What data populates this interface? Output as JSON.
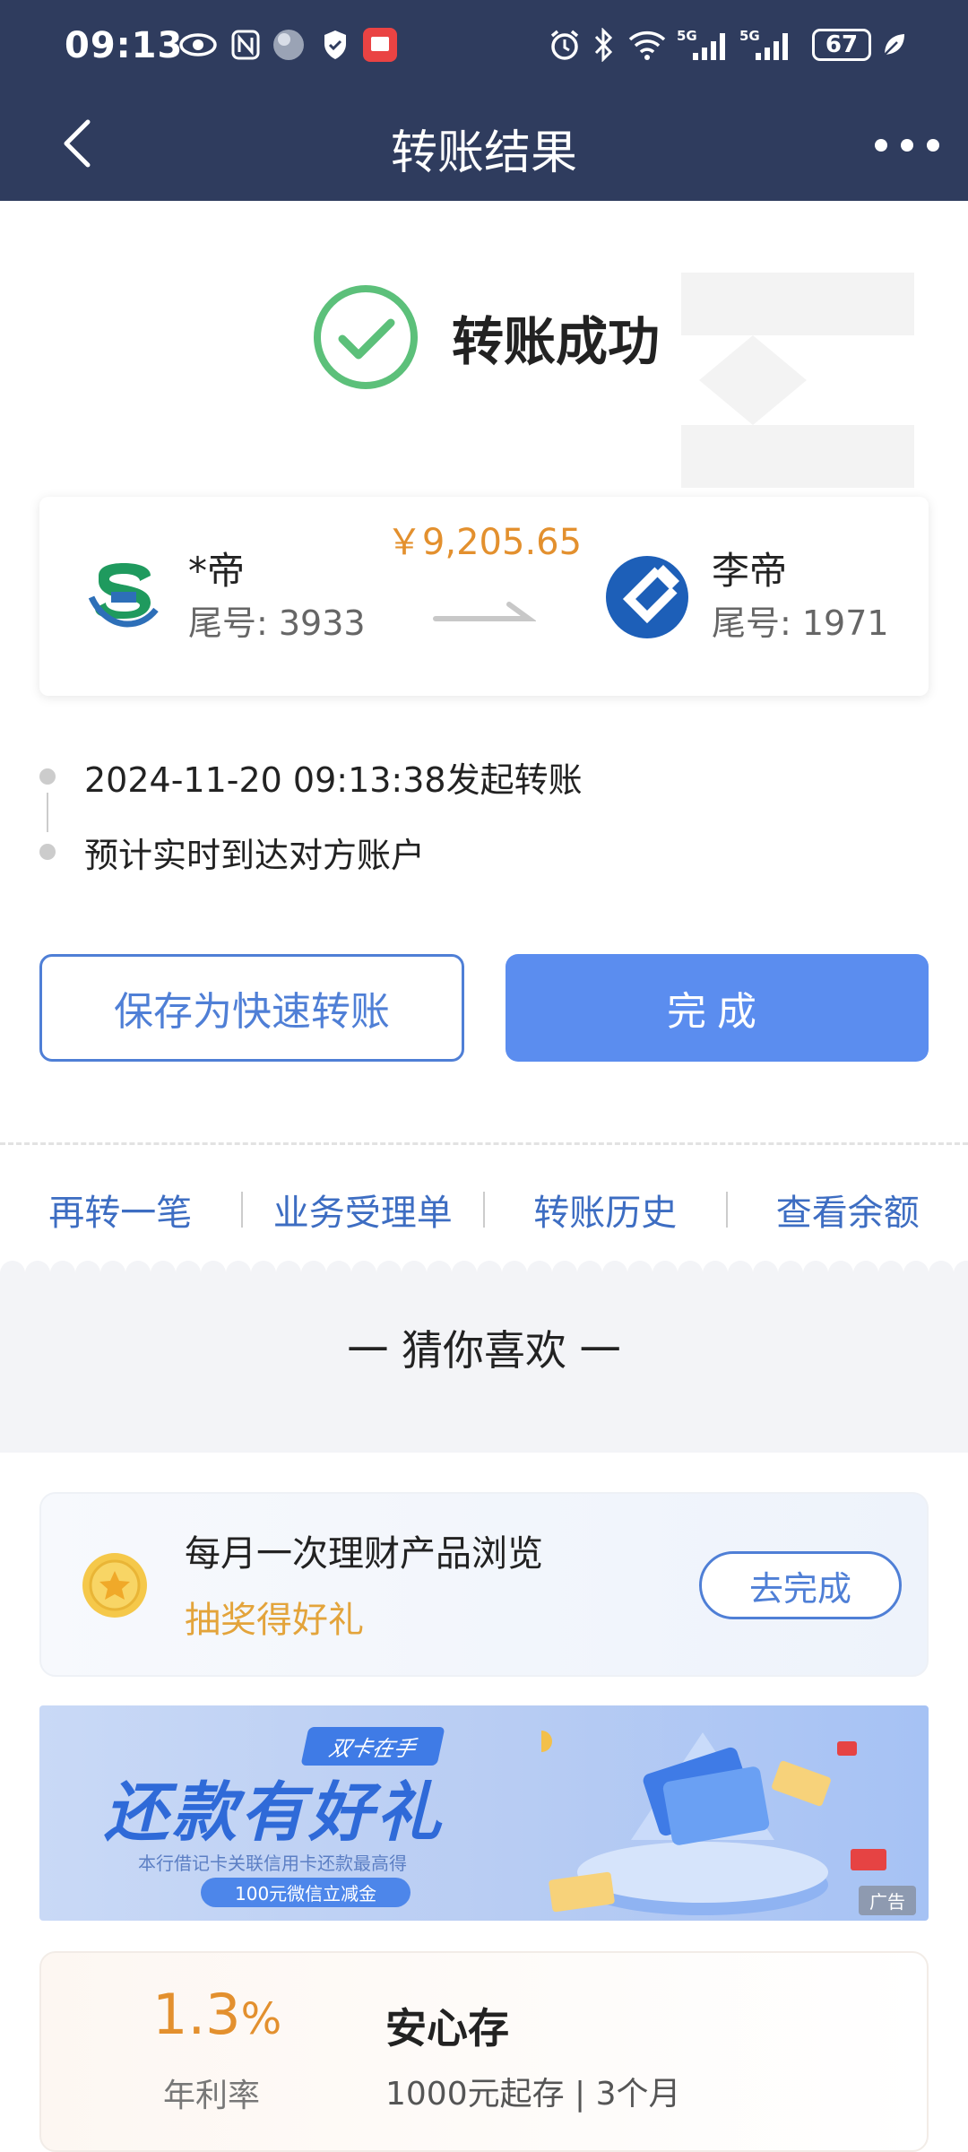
{
  "status_bar": {
    "time": "09:13",
    "battery": "67",
    "network_1": "5G",
    "network_2": "5G"
  },
  "header": {
    "title": "转账结果"
  },
  "result": {
    "status_text": "转账成功"
  },
  "transfer": {
    "amount": "￥9,205.65",
    "from": {
      "name": "*帝",
      "tail": "尾号: 3933"
    },
    "to": {
      "name": "李帝",
      "tail": "尾号: 1971"
    }
  },
  "timeline": [
    "2024-11-20 09:13:38发起转账",
    "预计实时到达对方账户"
  ],
  "buttons": {
    "save_quick": "保存为快速转账",
    "done": "完成"
  },
  "quick_links": [
    "再转一笔",
    "业务受理单",
    "转账历史",
    "查看余额"
  ],
  "recommend": {
    "heading": "一 猜你喜欢 一",
    "task": {
      "title": "每月一次理财产品浏览",
      "subtitle": "抽奖得好礼",
      "button": "去完成"
    },
    "banner": {
      "tag": "双卡在手",
      "title": "还款有好礼",
      "subtitle": "本行借记卡关联信用卡还款最高得",
      "pill": "100元微信立减金",
      "ad": "广告"
    },
    "deposit": {
      "rate": "1.3",
      "rate_unit": "%",
      "rate_label": "年利率",
      "name": "安心存",
      "desc": "1000元起存 | 3个月"
    }
  },
  "colors": {
    "header_bg": "#2f3c5e",
    "accent_blue": "#5b8def",
    "amount_orange": "#e3902e",
    "success_green": "#5cc07a"
  }
}
